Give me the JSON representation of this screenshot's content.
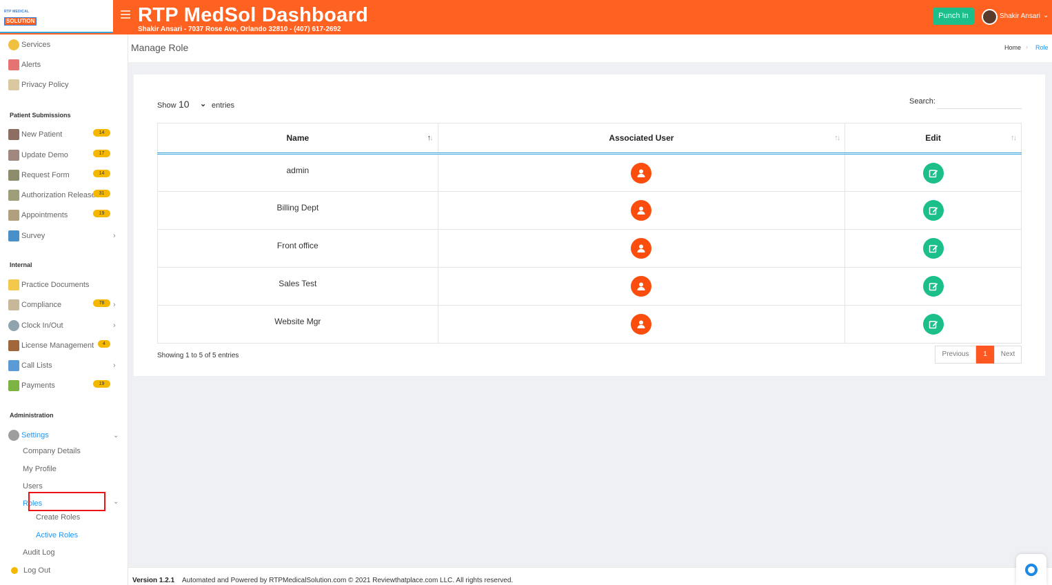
{
  "header": {
    "logo_line1": "RTP MEDICAL",
    "logo_line2": "SOLUTION",
    "title": "RTP MedSol Dashboard",
    "subtitle": "Shakir Ansari - 7037 Rose Ave, Orlando 32810 - (407) 617-2692",
    "punch_label": "Punch In",
    "user_name": "Shakir Ansari",
    "accent_color": "#ff6120"
  },
  "sidebar": {
    "top_items": [
      {
        "label": "Services",
        "icon": "services-icon"
      },
      {
        "label": "Alerts",
        "icon": "alerts-icon"
      },
      {
        "label": "Privacy Policy",
        "icon": "privacy-icon"
      }
    ],
    "sections": {
      "patient": "Patient Submissions",
      "internal": "Internal",
      "admin": "Administration"
    },
    "patient_items": [
      {
        "label": "New Patient",
        "badge": "14"
      },
      {
        "label": "Update Demo",
        "badge": "17"
      },
      {
        "label": "Request Form",
        "badge": "14"
      },
      {
        "label": "Authorization Release",
        "badge": "31"
      },
      {
        "label": "Appointments",
        "badge": "19"
      },
      {
        "label": "Survey"
      }
    ],
    "internal_items": [
      {
        "label": "Practice Documents"
      },
      {
        "label": "Compliance",
        "badge": "78"
      },
      {
        "label": "Clock In/Out"
      },
      {
        "label": "License Management",
        "badge": "4"
      },
      {
        "label": "Call Lists"
      },
      {
        "label": "Payments",
        "badge": "19"
      }
    ],
    "settings": {
      "label": "Settings",
      "company_details": "Company Details",
      "my_profile": "My Profile",
      "users": "Users",
      "roles": "Roles",
      "create_roles": "Create Roles",
      "active_roles": "Active Roles",
      "audit_log": "Audit Log"
    },
    "logout": "Log Out"
  },
  "page": {
    "title": "Manage Role",
    "breadcrumb_home": "Home",
    "breadcrumb_current": "Role"
  },
  "table": {
    "show_label": "Show",
    "entries_value": "10",
    "entries_label": "entries",
    "search_label": "Search:",
    "search_value": "",
    "columns": [
      "Name",
      "Associated User",
      "Edit"
    ],
    "rows": [
      {
        "name": "admin"
      },
      {
        "name": "Billing Dept"
      },
      {
        "name": "Front office"
      },
      {
        "name": "Sales Test"
      },
      {
        "name": "Website Mgr"
      }
    ],
    "showing_text": "Showing 1 to 5 of 5 entries",
    "pager": {
      "prev": "Previous",
      "current": "1",
      "next": "Next"
    }
  },
  "footer": {
    "version": "Version 1.2.1",
    "text": "Automated and Powered by RTPMedicalSolution.com © 2021 Reviewthatplace.com LLC. All rights reserved."
  }
}
